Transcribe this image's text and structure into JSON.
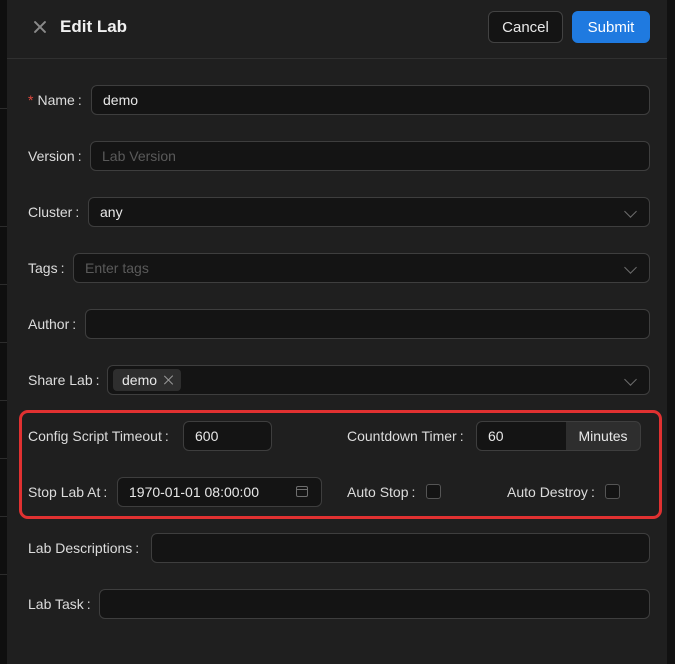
{
  "header": {
    "title": "Edit Lab",
    "cancel_label": "Cancel",
    "submit_label": "Submit"
  },
  "form": {
    "name": {
      "label": "Name",
      "colon": ":",
      "value": "demo",
      "required": true
    },
    "version": {
      "label": "Version",
      "colon": ":",
      "placeholder": "Lab Version",
      "value": ""
    },
    "cluster": {
      "label": "Cluster",
      "colon": ":",
      "value": "any"
    },
    "tags": {
      "label": "Tags",
      "colon": ":",
      "placeholder": "Enter tags"
    },
    "author": {
      "label": "Author",
      "colon": ":",
      "value": ""
    },
    "share_lab": {
      "label": "Share Lab",
      "colon": ":",
      "tags": [
        "demo"
      ]
    },
    "config_script_timeout": {
      "label": "Config Script Timeout",
      "colon": ":",
      "value": "600"
    },
    "countdown_timer": {
      "label": "Countdown Timer",
      "colon": ":",
      "value": "60",
      "unit": "Minutes"
    },
    "stop_lab_at": {
      "label": "Stop Lab At",
      "colon": ":",
      "value": "1970-01-01 08:00:00"
    },
    "auto_stop": {
      "label": "Auto Stop",
      "colon": ":",
      "checked": false
    },
    "auto_destroy": {
      "label": "Auto Destroy",
      "colon": ":",
      "checked": false
    },
    "lab_descriptions": {
      "label": "Lab Descriptions",
      "colon": ":",
      "value": ""
    },
    "lab_task": {
      "label": "Lab Task",
      "colon": ":",
      "value": ""
    }
  },
  "colors": {
    "primary": "#1f7ae0",
    "highlight_border": "#e03131",
    "required_mark": "#e0483e"
  },
  "icons": {
    "close": "close-icon",
    "dropdown": "chevron-down-icon",
    "tag_remove": "close-icon",
    "date": "calendar-icon"
  }
}
